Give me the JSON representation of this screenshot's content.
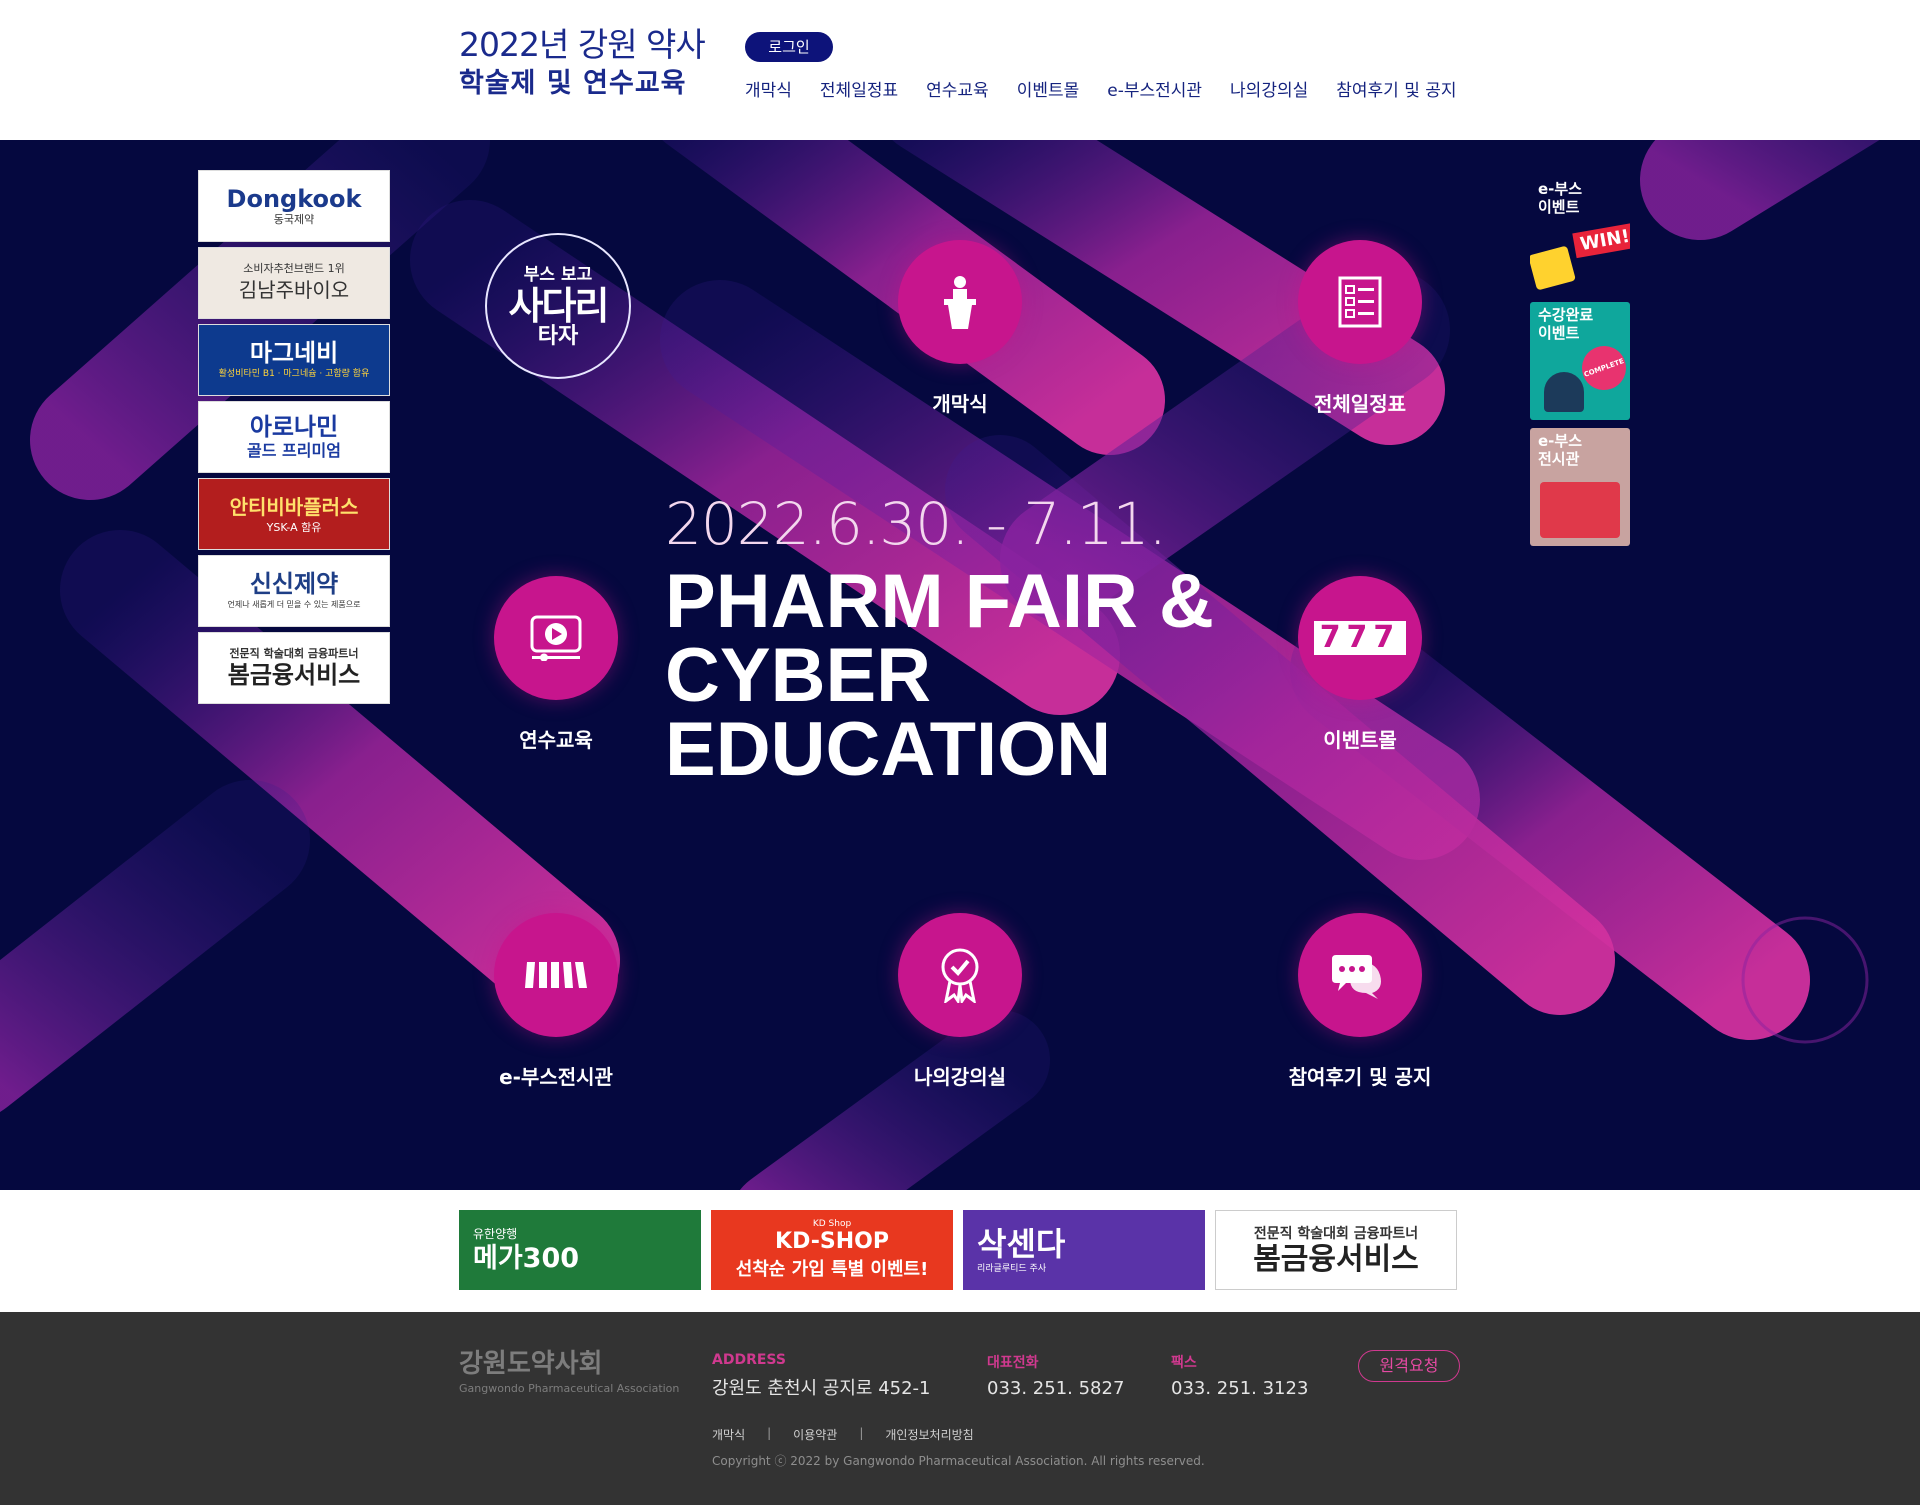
{
  "header": {
    "logo_line1": "2022년 강원 약사",
    "logo_line2": "학술제 및 연수교육",
    "login_label": "로그인",
    "nav": [
      "개막식",
      "전체일정표",
      "연수교육",
      "이벤트몰",
      "e-부스전시관",
      "나의강의실",
      "참여후기 및 공지"
    ]
  },
  "hero": {
    "badge_small": "부스 보고",
    "badge_big": "사다리",
    "badge_bottom": "타자",
    "date": "2022.6.30. - 7.11.",
    "title_line1": "PHARM FAIR &",
    "title_line2": "CYBER",
    "title_line3": "EDUCATION",
    "nodes": [
      {
        "label": "개막식",
        "icon": "podium-icon"
      },
      {
        "label": "전체일정표",
        "icon": "checklist-icon"
      },
      {
        "label": "연수교육",
        "icon": "video-play-icon"
      },
      {
        "label": "이벤트몰",
        "icon": "slot-777-icon"
      },
      {
        "label": "e-부스전시관",
        "icon": "awning-icon"
      },
      {
        "label": "나의강의실",
        "icon": "award-badge-icon"
      },
      {
        "label": "참여후기 및 공지",
        "icon": "chat-bubbles-icon"
      }
    ],
    "slot_text": "777"
  },
  "side_banners": [
    {
      "main": "Dongkook",
      "sub": "동국제약"
    },
    {
      "main": "김남주바이오",
      "sub": "소비자추천브랜드 1위"
    },
    {
      "main": "마그네비",
      "sub": "활성비타민 B1 · 마그네슘 · 고함량 함유"
    },
    {
      "main": "아로나민",
      "sub": "골드 프리미엄"
    },
    {
      "main": "안티비바플러스",
      "sub": "YSK-A 함유"
    },
    {
      "main": "신신제약",
      "sub": "언제나 새롭게 더 믿을 수 있는 제품으로"
    },
    {
      "main": "봄금융서비스",
      "sub": "전문직 학술대회 금융파트너"
    }
  ],
  "right_banners": [
    {
      "line1": "e-부스",
      "line2": "이벤트",
      "extra": "WIN!"
    },
    {
      "line1": "수강완료",
      "line2": "이벤트",
      "extra": "COMPLETE"
    },
    {
      "line1": "e-부스",
      "line2": "전시관",
      "extra": ""
    }
  ],
  "bottom_banners": [
    {
      "small": "유한양행",
      "main": "메가300"
    },
    {
      "small": "KD Shop",
      "main": "KD-SHOP",
      "sub": "선착순 가입 특별 이벤트!"
    },
    {
      "small": "리라글루티드 주사",
      "main": "삭센다"
    },
    {
      "small": "전문직 학술대회 금융파트너",
      "main": "봄금융서비스"
    }
  ],
  "footer": {
    "logo_main": "강원도약사회",
    "logo_sub": "Gangwondo Pharmaceutical Association",
    "address_label": "ADDRESS",
    "address": "강원도 춘천시 공지로 452-1",
    "phone_label": "대표전화",
    "phone": "033. 251. 5827",
    "fax_label": "팩스",
    "fax": "033. 251. 3123",
    "remote_label": "원격요청",
    "links": [
      "개막식",
      "이용약관",
      "개인정보처리방침"
    ],
    "copyright": "Copyright ⓒ 2022 by Gangwondo Pharmaceutical Association. All rights reserved."
  },
  "colors": {
    "navy": "#1a2a8c",
    "hero_bg": "#05083f",
    "magenta": "#c7158d",
    "footer_bg": "#333333"
  }
}
